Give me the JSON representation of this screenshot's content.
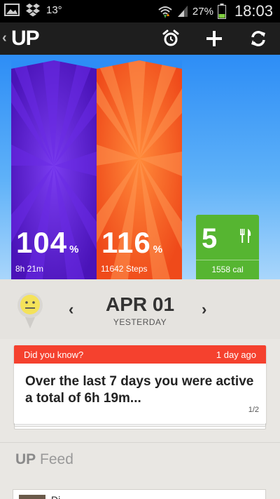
{
  "status_bar": {
    "temperature": "13°",
    "battery_percent": "27%",
    "time": "18:03",
    "icons": [
      "gallery-icon",
      "dropbox-icon",
      "wifi-icon",
      "signal-icon",
      "battery-icon"
    ]
  },
  "app_bar": {
    "title": "UP",
    "actions": [
      "alarm-icon",
      "add-icon",
      "sync-icon"
    ]
  },
  "hero": {
    "sleep": {
      "value": "104",
      "unit": "%",
      "detail": "8h 21m",
      "color": "#5a1fd3"
    },
    "steps": {
      "value": "116",
      "unit": "%",
      "detail": "11642 Steps",
      "color": "#f55a22"
    },
    "eat": {
      "value": "5",
      "detail": "1558 cal",
      "color": "#56b531"
    }
  },
  "date_nav": {
    "date": "APR 01",
    "relative": "YESTERDAY"
  },
  "insight_card": {
    "heading": "Did you know?",
    "age": "1 day ago",
    "body": "Over the last 7 days you were active a total of 6h 19m...",
    "page": "1/2"
  },
  "feed": {
    "title_bold": "UP",
    "title_rest": " Feed",
    "first_item_text": "Di"
  }
}
